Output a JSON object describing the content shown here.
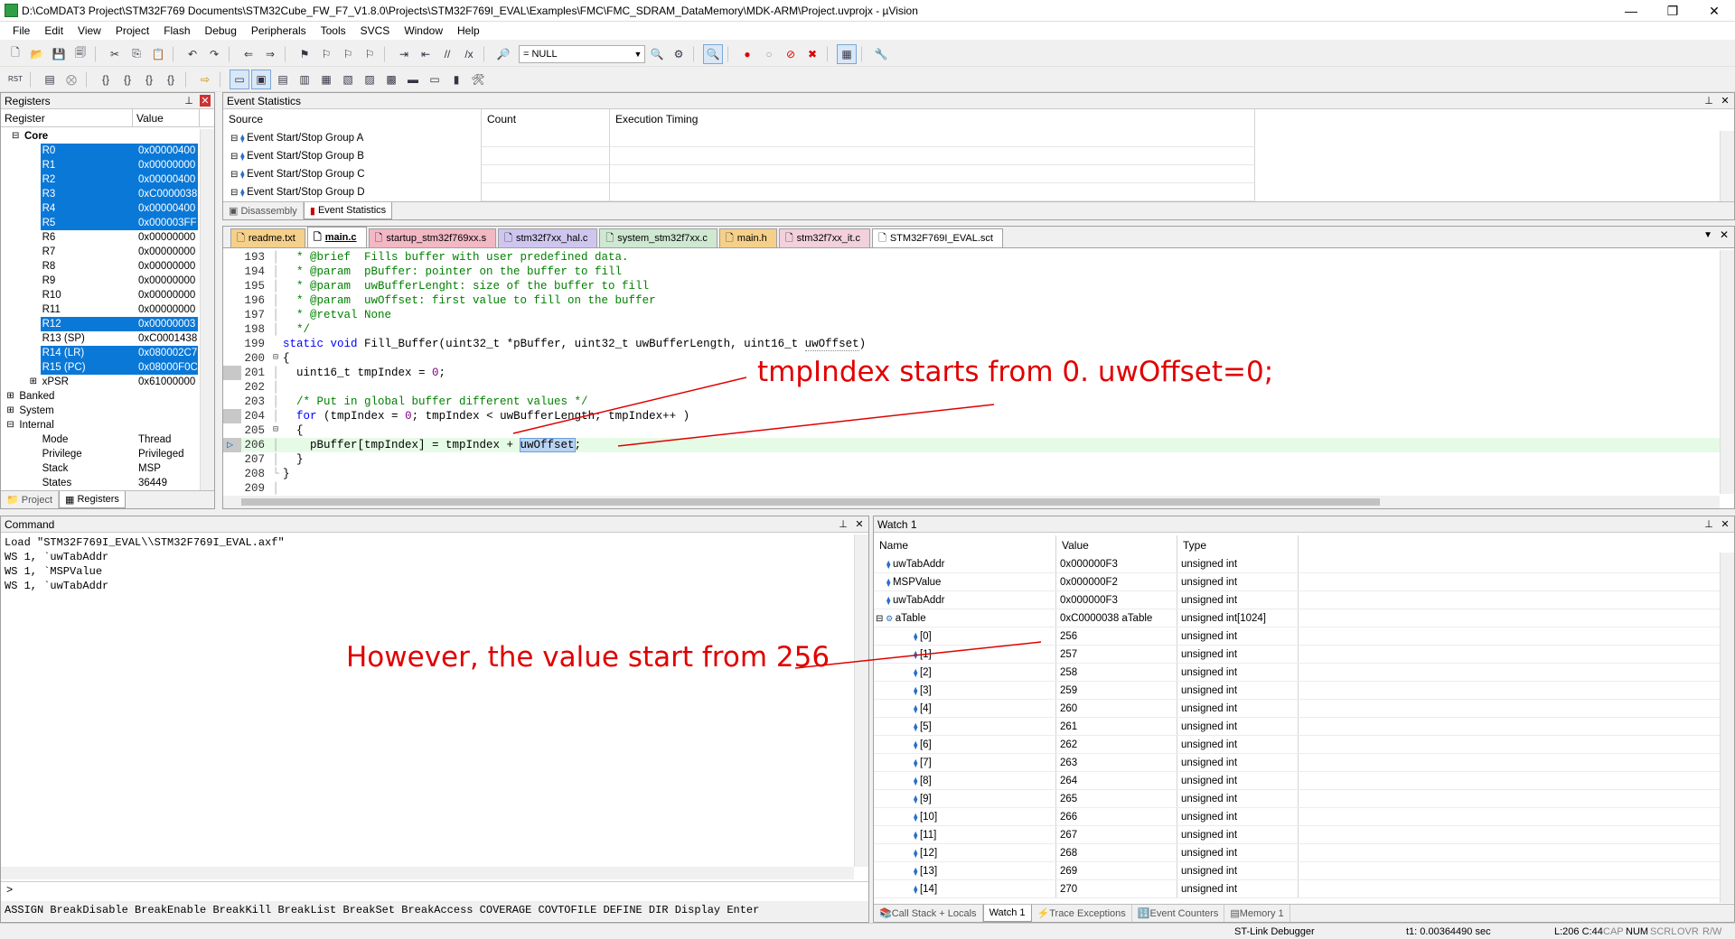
{
  "window": {
    "title": "D:\\CoMDAT3 Project\\STM32F769 Documents\\STM32Cube_FW_F7_V1.8.0\\Projects\\STM32F769I_EVAL\\Examples\\FMC\\FMC_SDRAM_DataMemory\\MDK-ARM\\Project.uvprojx - µVision",
    "minimize": "—",
    "maximize": "❐",
    "close": "✕"
  },
  "menu": [
    "File",
    "Edit",
    "View",
    "Project",
    "Flash",
    "Debug",
    "Peripherals",
    "Tools",
    "SVCS",
    "Window",
    "Help"
  ],
  "toolbar": {
    "null_label": "= NULL"
  },
  "registers": {
    "title": "Registers",
    "col_register": "Register",
    "col_value": "Value",
    "core_label": "Core",
    "core": [
      {
        "name": "R0",
        "value": "0x00000400",
        "selected": true
      },
      {
        "name": "R1",
        "value": "0x00000000",
        "selected": true
      },
      {
        "name": "R2",
        "value": "0x00000400",
        "selected": true
      },
      {
        "name": "R3",
        "value": "0xC0000038",
        "selected": true
      },
      {
        "name": "R4",
        "value": "0x00000400",
        "selected": true
      },
      {
        "name": "R5",
        "value": "0x000003FF",
        "selected": true
      },
      {
        "name": "R6",
        "value": "0x00000000",
        "selected": false
      },
      {
        "name": "R7",
        "value": "0x00000000",
        "selected": false
      },
      {
        "name": "R8",
        "value": "0x00000000",
        "selected": false
      },
      {
        "name": "R9",
        "value": "0x00000000",
        "selected": false
      },
      {
        "name": "R10",
        "value": "0x00000000",
        "selected": false
      },
      {
        "name": "R11",
        "value": "0x00000000",
        "selected": false
      },
      {
        "name": "R12",
        "value": "0x00000003",
        "selected": true
      },
      {
        "name": "R13 (SP)",
        "value": "0xC0001438",
        "selected": false
      },
      {
        "name": "R14 (LR)",
        "value": "0x080002C7",
        "selected": true
      },
      {
        "name": "R15 (PC)",
        "value": "0x08000F0C",
        "selected": true
      },
      {
        "name": "xPSR",
        "value": "0x61000000",
        "selected": false
      }
    ],
    "groups": [
      "Banked",
      "System",
      "Internal"
    ],
    "internal": [
      {
        "name": "Mode",
        "value": "Thread"
      },
      {
        "name": "Privilege",
        "value": "Privileged"
      },
      {
        "name": "Stack",
        "value": "MSP"
      },
      {
        "name": "States",
        "value": "36449"
      }
    ],
    "tab_project": "Project",
    "tab_registers": "Registers"
  },
  "event_stats": {
    "title": "Event Statistics",
    "col_source": "Source",
    "col_count": "Count",
    "col_timing": "Execution Timing",
    "groups": [
      "Event Start/Stop Group A",
      "Event Start/Stop Group B",
      "Event Start/Stop Group C",
      "Event Start/Stop Group D"
    ],
    "tab_disassembly": "Disassembly",
    "tab_event_statistics": "Event Statistics"
  },
  "editor": {
    "tabs": [
      {
        "label": "readme.txt",
        "color": "#f5d08a"
      },
      {
        "label": "main.c",
        "color": "#f5d08a",
        "active": true
      },
      {
        "label": "startup_stm32f769xx.s",
        "color": "#f2b8c4"
      },
      {
        "label": "stm32f7xx_hal.c",
        "color": "#cfc6ef"
      },
      {
        "label": "system_stm32f7xx.c",
        "color": "#cfe8d2"
      },
      {
        "label": "main.h",
        "color": "#f5d08a"
      },
      {
        "label": "stm32f7xx_it.c",
        "color": "#f2d0dc"
      },
      {
        "label": "STM32F769I_EVAL.sct",
        "color": "#ffffff"
      }
    ],
    "lines": [
      {
        "n": "193",
        "text": "  * @brief  Fills buffer with user predefined data."
      },
      {
        "n": "194",
        "text": "  * @param  pBuffer: pointer on the buffer to fill"
      },
      {
        "n": "195",
        "text": "  * @param  uwBufferLenght: size of the buffer to fill"
      },
      {
        "n": "196",
        "text": "  * @param  uwOffset: first value to fill on the buffer"
      },
      {
        "n": "197",
        "text": "  * @retval None"
      },
      {
        "n": "198",
        "text": "  */"
      },
      {
        "n": "199",
        "text": "static void Fill_Buffer(uint32_t *pBuffer, uint32_t uwBufferLength, uint16_t uwOffset)"
      },
      {
        "n": "200",
        "text": "{"
      },
      {
        "n": "201",
        "text": "  uint16_t tmpIndex = 0;"
      },
      {
        "n": "202",
        "text": ""
      },
      {
        "n": "203",
        "text": "  /* Put in global buffer different values */"
      },
      {
        "n": "204",
        "text": "  for (tmpIndex = 0; tmpIndex < uwBufferLength; tmpIndex++ )"
      },
      {
        "n": "205",
        "text": "  {"
      },
      {
        "n": "206",
        "text": "    pBuffer[tmpIndex] = tmpIndex + uwOffset;"
      },
      {
        "n": "207",
        "text": "  }"
      },
      {
        "n": "208",
        "text": "}"
      },
      {
        "n": "209",
        "text": ""
      }
    ]
  },
  "command": {
    "title": "Command",
    "lines": [
      "Load \"STM32F769I_EVAL\\\\STM32F769I_EVAL.axf\"",
      "WS 1, `uwTabAddr",
      "WS 1, `MSPValue",
      "WS 1, `uwTabAddr"
    ],
    "prompt": ">",
    "help": "ASSIGN BreakDisable BreakEnable BreakKill BreakList BreakSet BreakAccess COVERAGE COVTOFILE DEFINE DIR Display Enter"
  },
  "watch": {
    "title": "Watch 1",
    "col_name": "Name",
    "col_value": "Value",
    "col_type": "Type",
    "rows": [
      {
        "name": "uwTabAddr",
        "value": "0x000000F3",
        "type": "unsigned int",
        "indent": 0
      },
      {
        "name": "MSPValue",
        "value": "0x000000F2",
        "type": "unsigned int",
        "indent": 0
      },
      {
        "name": "uwTabAddr",
        "value": "0x000000F3",
        "type": "unsigned int",
        "indent": 0
      },
      {
        "name": "aTable",
        "value": "0xC0000038 aTable",
        "type": "unsigned int[1024]",
        "indent": 0,
        "expand": true
      },
      {
        "name": "[0]",
        "value": "256",
        "type": "unsigned int",
        "indent": 1
      },
      {
        "name": "[1]",
        "value": "257",
        "type": "unsigned int",
        "indent": 1
      },
      {
        "name": "[2]",
        "value": "258",
        "type": "unsigned int",
        "indent": 1
      },
      {
        "name": "[3]",
        "value": "259",
        "type": "unsigned int",
        "indent": 1
      },
      {
        "name": "[4]",
        "value": "260",
        "type": "unsigned int",
        "indent": 1
      },
      {
        "name": "[5]",
        "value": "261",
        "type": "unsigned int",
        "indent": 1
      },
      {
        "name": "[6]",
        "value": "262",
        "type": "unsigned int",
        "indent": 1
      },
      {
        "name": "[7]",
        "value": "263",
        "type": "unsigned int",
        "indent": 1
      },
      {
        "name": "[8]",
        "value": "264",
        "type": "unsigned int",
        "indent": 1
      },
      {
        "name": "[9]",
        "value": "265",
        "type": "unsigned int",
        "indent": 1
      },
      {
        "name": "[10]",
        "value": "266",
        "type": "unsigned int",
        "indent": 1
      },
      {
        "name": "[11]",
        "value": "267",
        "type": "unsigned int",
        "indent": 1
      },
      {
        "name": "[12]",
        "value": "268",
        "type": "unsigned int",
        "indent": 1
      },
      {
        "name": "[13]",
        "value": "269",
        "type": "unsigned int",
        "indent": 1
      },
      {
        "name": "[14]",
        "value": "270",
        "type": "unsigned int",
        "indent": 1
      }
    ],
    "tabs": [
      "Call Stack + Locals",
      "Watch 1",
      "Trace Exceptions",
      "Event Counters",
      "Memory 1"
    ]
  },
  "annotations": {
    "top": "tmpIndex starts from 0. uwOffset=0;",
    "bottom": "However, the value start from 256"
  },
  "status": {
    "debugger": "ST-Link Debugger",
    "time": "t1: 0.00364490 sec",
    "pos": "L:206 C:44",
    "caps": "CAP",
    "num": "NUM",
    "scrl": "SCRL",
    "ovr": "OVR",
    "rw": "R/W"
  }
}
